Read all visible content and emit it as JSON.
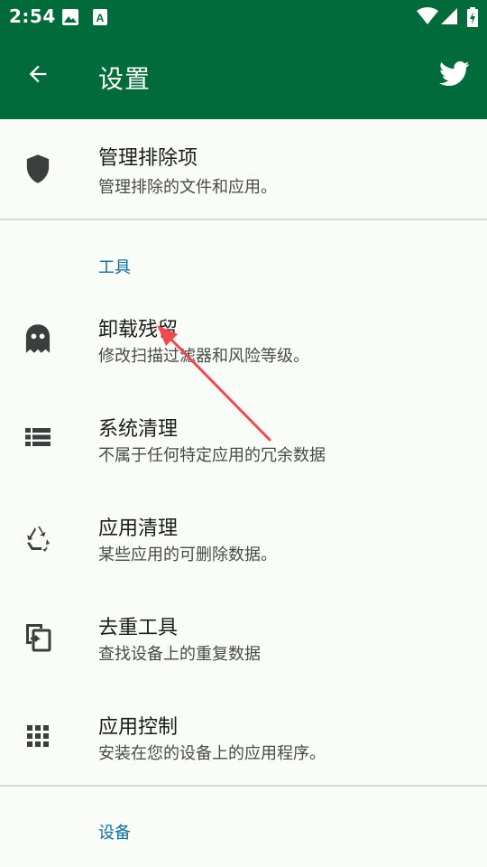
{
  "status_bar": {
    "time": "2:54"
  },
  "app_bar": {
    "title": "设置"
  },
  "items": {
    "exclusions": {
      "title": "管理排除项",
      "subtitle": "管理排除的文件和应用。"
    },
    "corpse": {
      "title": "卸载残留",
      "subtitle": "修改扫描过滤器和风险等级。"
    },
    "system": {
      "title": "系统清理",
      "subtitle": "不属于任何特定应用的冗余数据"
    },
    "app_cleaner": {
      "title": "应用清理",
      "subtitle": "某些应用的可删除数据。"
    },
    "dedup": {
      "title": "去重工具",
      "subtitle": "查找设备上的重复数据"
    },
    "app_control": {
      "title": "应用控制",
      "subtitle": "安装在您的设备上的应用程序。"
    }
  },
  "sections": {
    "tools": "工具",
    "device": "设备"
  },
  "icons": {
    "back": "arrow-left-icon",
    "twitter": "twitter-icon",
    "exclusions": "shield-icon",
    "corpse": "ghost-icon",
    "system": "list-icon",
    "app_cleaner": "recycle-icon",
    "dedup": "duplicate-icon",
    "app_control": "grid-icon"
  },
  "colors": {
    "app_bar": "#016b3b",
    "section_header": "#0a6fa0",
    "annotation_arrow": "#f04a50"
  }
}
